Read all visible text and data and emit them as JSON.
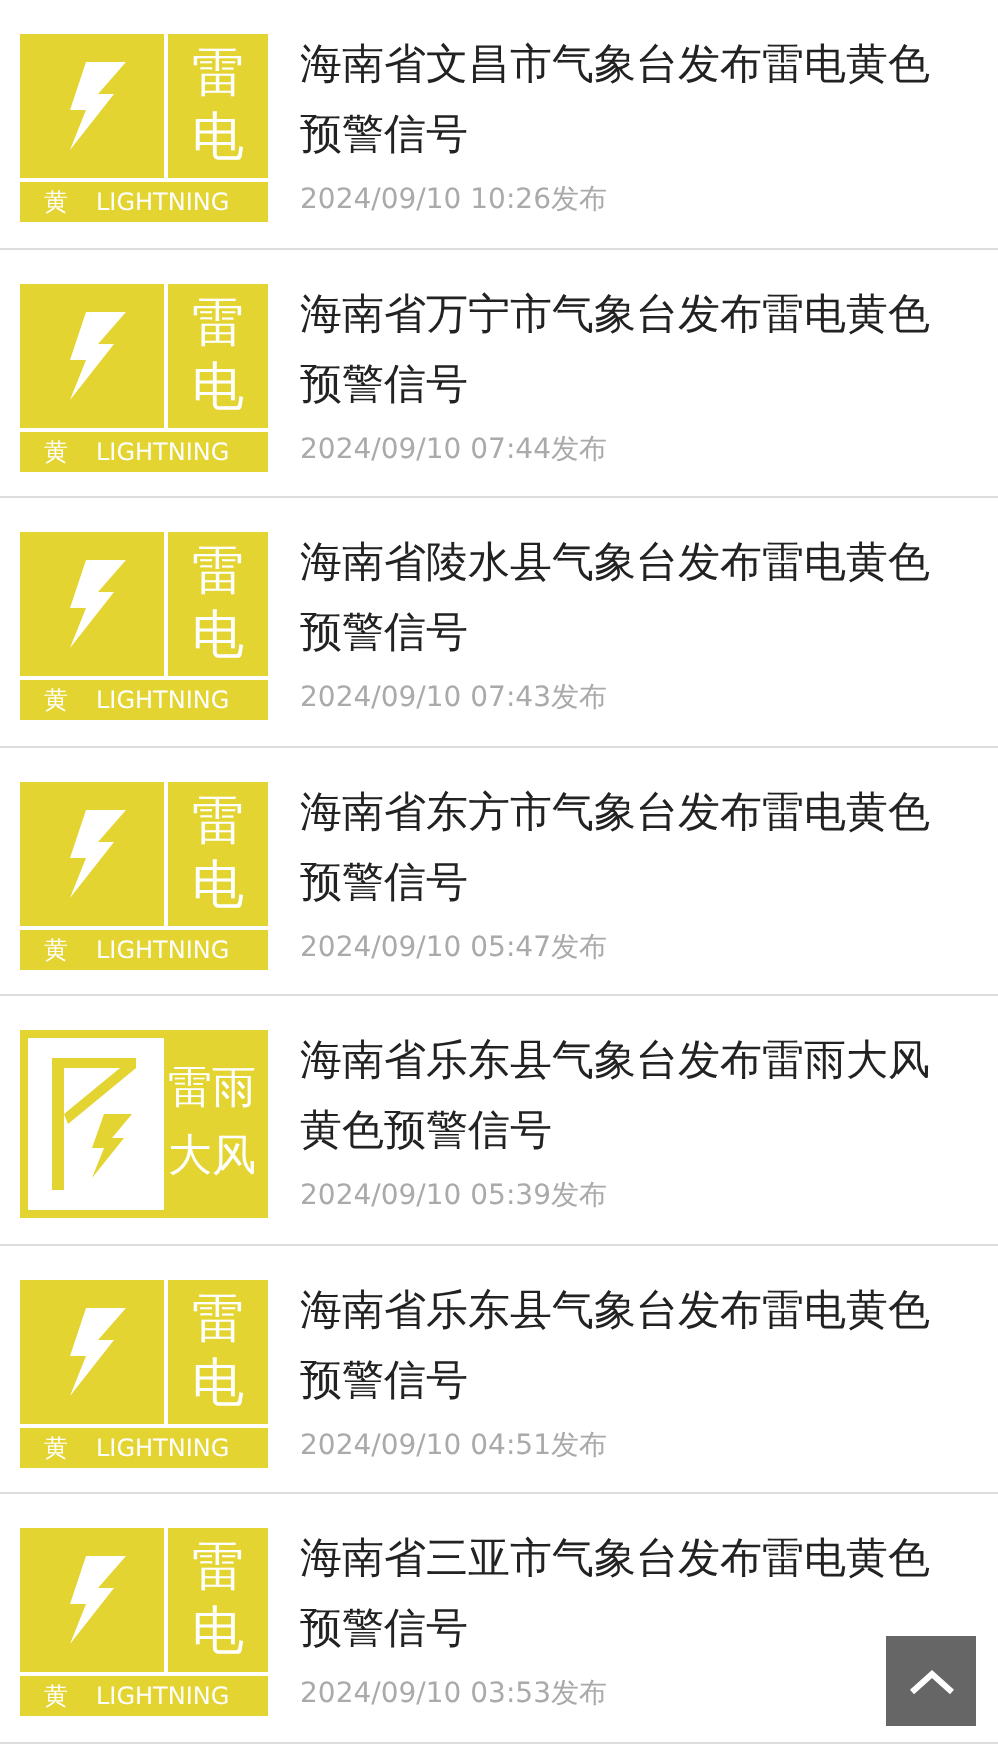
{
  "alerts": [
    {
      "kind": "lightning",
      "icon_texts": [
        "雷",
        "电",
        "黄",
        "LIGHTNING"
      ],
      "title": "海南省文昌市气象台发布雷电黄色预警信号",
      "time": "2024/09/10 10:26发布"
    },
    {
      "kind": "lightning",
      "icon_texts": [
        "雷",
        "电",
        "黄",
        "LIGHTNING"
      ],
      "title": "海南省万宁市气象台发布雷电黄色预警信号",
      "time": "2024/09/10 07:44发布"
    },
    {
      "kind": "lightning",
      "icon_texts": [
        "雷",
        "电",
        "黄",
        "LIGHTNING"
      ],
      "title": "海南省陵水县气象台发布雷电黄色预警信号",
      "time": "2024/09/10 07:43发布"
    },
    {
      "kind": "lightning",
      "icon_texts": [
        "雷",
        "电",
        "黄",
        "LIGHTNING"
      ],
      "title": "海南省东方市气象台发布雷电黄色预警信号",
      "time": "2024/09/10 05:47发布"
    },
    {
      "kind": "thunderstorm_wind",
      "icon_texts": [
        "雷雨",
        "大风"
      ],
      "title": "海南省乐东县气象台发布雷雨大风黄色预警信号",
      "time": "2024/09/10 05:39发布"
    },
    {
      "kind": "lightning",
      "icon_texts": [
        "雷",
        "电",
        "黄",
        "LIGHTNING"
      ],
      "title": "海南省乐东县气象台发布雷电黄色预警信号",
      "time": "2024/09/10 04:51发布"
    },
    {
      "kind": "lightning",
      "icon_texts": [
        "雷",
        "电",
        "黄",
        "LIGHTNING"
      ],
      "title": "海南省三亚市气象台发布雷电黄色预警信号",
      "time": "2024/09/10 03:53发布"
    }
  ]
}
